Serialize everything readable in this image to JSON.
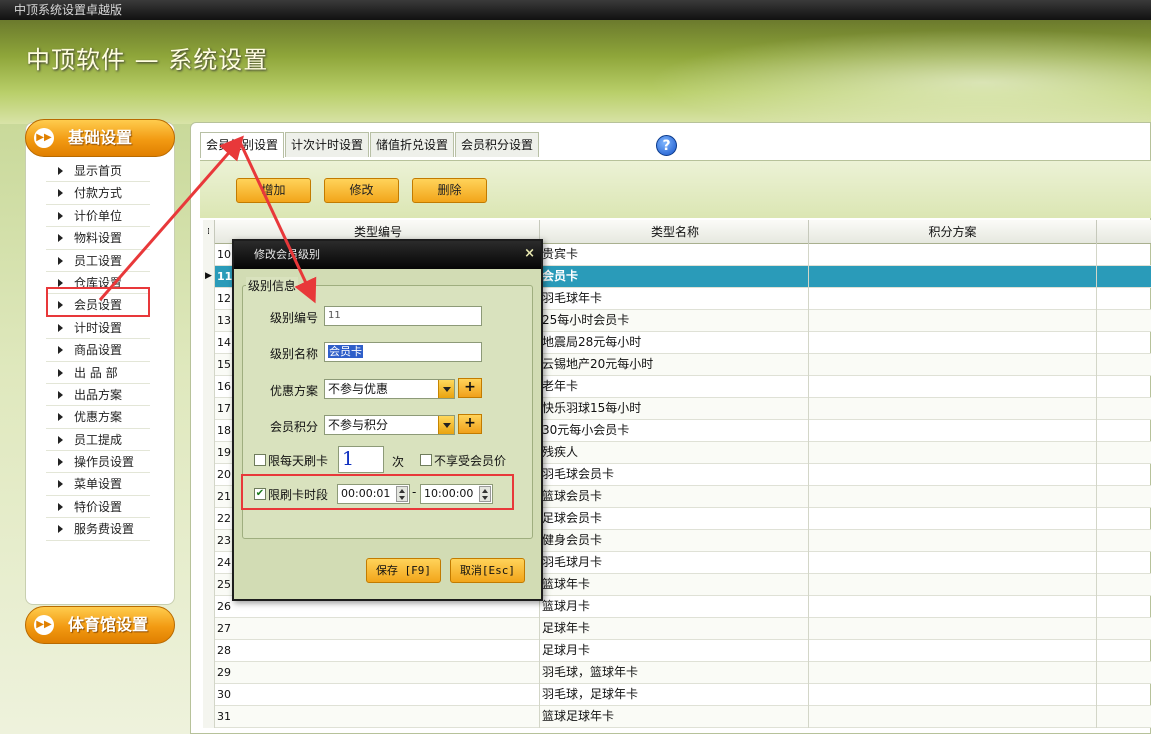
{
  "window": {
    "title": "中顶系统设置卓越版"
  },
  "brand": {
    "title": "中顶软件 — 系统设置"
  },
  "sidebar": {
    "section1": "基础设置",
    "section2": "体育馆设置",
    "items": [
      {
        "label": "显示首页"
      },
      {
        "label": "付款方式"
      },
      {
        "label": "计价单位"
      },
      {
        "label": "物料设置"
      },
      {
        "label": "员工设置"
      },
      {
        "label": "仓库设置"
      },
      {
        "label": "会员设置"
      },
      {
        "label": "计时设置"
      },
      {
        "label": "商品设置"
      },
      {
        "label": "出 品 部"
      },
      {
        "label": "出品方案"
      },
      {
        "label": "优惠方案"
      },
      {
        "label": "员工提成"
      },
      {
        "label": "操作员设置"
      },
      {
        "label": "菜单设置"
      },
      {
        "label": "特价设置"
      },
      {
        "label": "服务费设置"
      }
    ]
  },
  "tabs": [
    {
      "label": "会员级别设置"
    },
    {
      "label": "计次计时设置"
    },
    {
      "label": "储值折兑设置"
    },
    {
      "label": "会员积分设置"
    }
  ],
  "toolbar": {
    "add": "增加",
    "edit": "修改",
    "delete": "删除"
  },
  "grid": {
    "columns": [
      "类型编号",
      "类型名称",
      "积分方案"
    ],
    "rows": [
      {
        "id": "10",
        "name": "贵宾卡"
      },
      {
        "id": "11",
        "name": "会员卡"
      },
      {
        "id": "12",
        "name": "羽毛球年卡"
      },
      {
        "id": "13",
        "name": "25每小时会员卡"
      },
      {
        "id": "14",
        "name": "地震局28元每小时"
      },
      {
        "id": "15",
        "name": "云锡地产20元每小时"
      },
      {
        "id": "16",
        "name": "老年卡"
      },
      {
        "id": "17",
        "name": "快乐羽球15每小时"
      },
      {
        "id": "18",
        "name": "30元每小会员卡"
      },
      {
        "id": "19",
        "name": "残疾人"
      },
      {
        "id": "20",
        "name": "羽毛球会员卡"
      },
      {
        "id": "21",
        "name": "篮球会员卡"
      },
      {
        "id": "22",
        "name": "足球会员卡"
      },
      {
        "id": "23",
        "name": "健身会员卡"
      },
      {
        "id": "24",
        "name": "羽毛球月卡"
      },
      {
        "id": "25",
        "name": "篮球年卡"
      },
      {
        "id": "26",
        "name": "篮球月卡"
      },
      {
        "id": "27",
        "name": "足球年卡"
      },
      {
        "id": "28",
        "name": "足球月卡"
      },
      {
        "id": "29",
        "name": "羽毛球，篮球年卡"
      },
      {
        "id": "30",
        "name": "羽毛球，足球年卡"
      },
      {
        "id": "31",
        "name": "篮球足球年卡"
      }
    ]
  },
  "dialog": {
    "title": "修改会员级别",
    "close": "×",
    "group_title": "级别信息",
    "level_id_label": "级别编号",
    "level_id_value": "11",
    "level_name_label": "级别名称",
    "level_name_value": "会员卡",
    "discount_label": "优惠方案",
    "discount_value": "不参与优惠",
    "points_label": "会员积分",
    "points_value": "不参与积分",
    "plus": "+",
    "daily_limit_label": "限每天刷卡",
    "daily_limit_value": "1",
    "times_unit": "次",
    "no_member_price_label": "不享受会员价",
    "time_limit_label": "限刷卡时段",
    "time_start": "00:00:01",
    "time_sep": "-",
    "time_end": "10:00:00",
    "save": "保存 [F9]",
    "cancel": "取消[Esc]"
  },
  "icons": {
    "help": "?",
    "check": "✔"
  },
  "colors": {
    "accent_orange": "#f2a51a",
    "selected_row": "#2a9bb9",
    "annotation_red": "#e8383a"
  }
}
